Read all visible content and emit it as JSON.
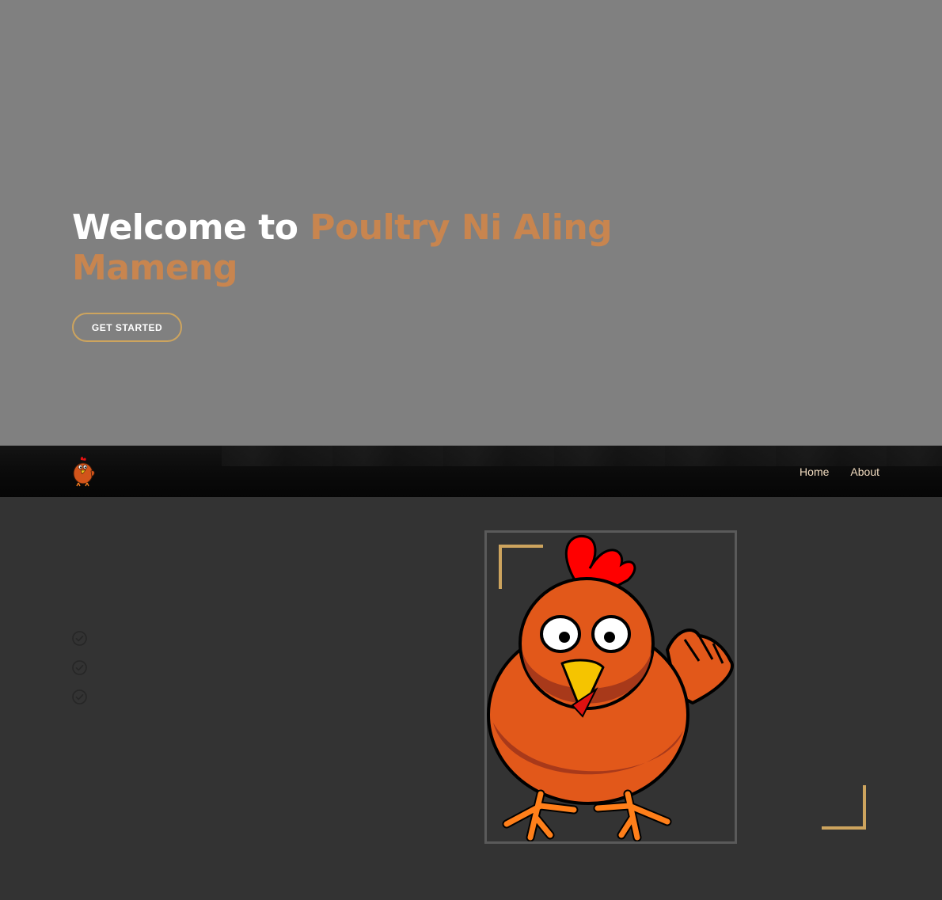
{
  "hero": {
    "title_white": "Welcome to ",
    "title_accent": "Poultry Ni Aling Mameng",
    "cta_label": "GET STARTED"
  },
  "nav": {
    "logo_icon": "chicken-logo-icon",
    "links": [
      {
        "label": "Home"
      },
      {
        "label": "About"
      }
    ]
  },
  "about": {
    "check_icons": [
      "check-circle-icon",
      "check-circle-icon",
      "check-circle-icon"
    ],
    "image_icon": "chicken-illustration"
  },
  "colors": {
    "hero_bg": "#808080",
    "accent": "#c8854f",
    "gold": "#cda45e",
    "page_bg": "#333333",
    "nav_bg": "#0a0a0a",
    "nav_link": "#f2dcc0"
  }
}
